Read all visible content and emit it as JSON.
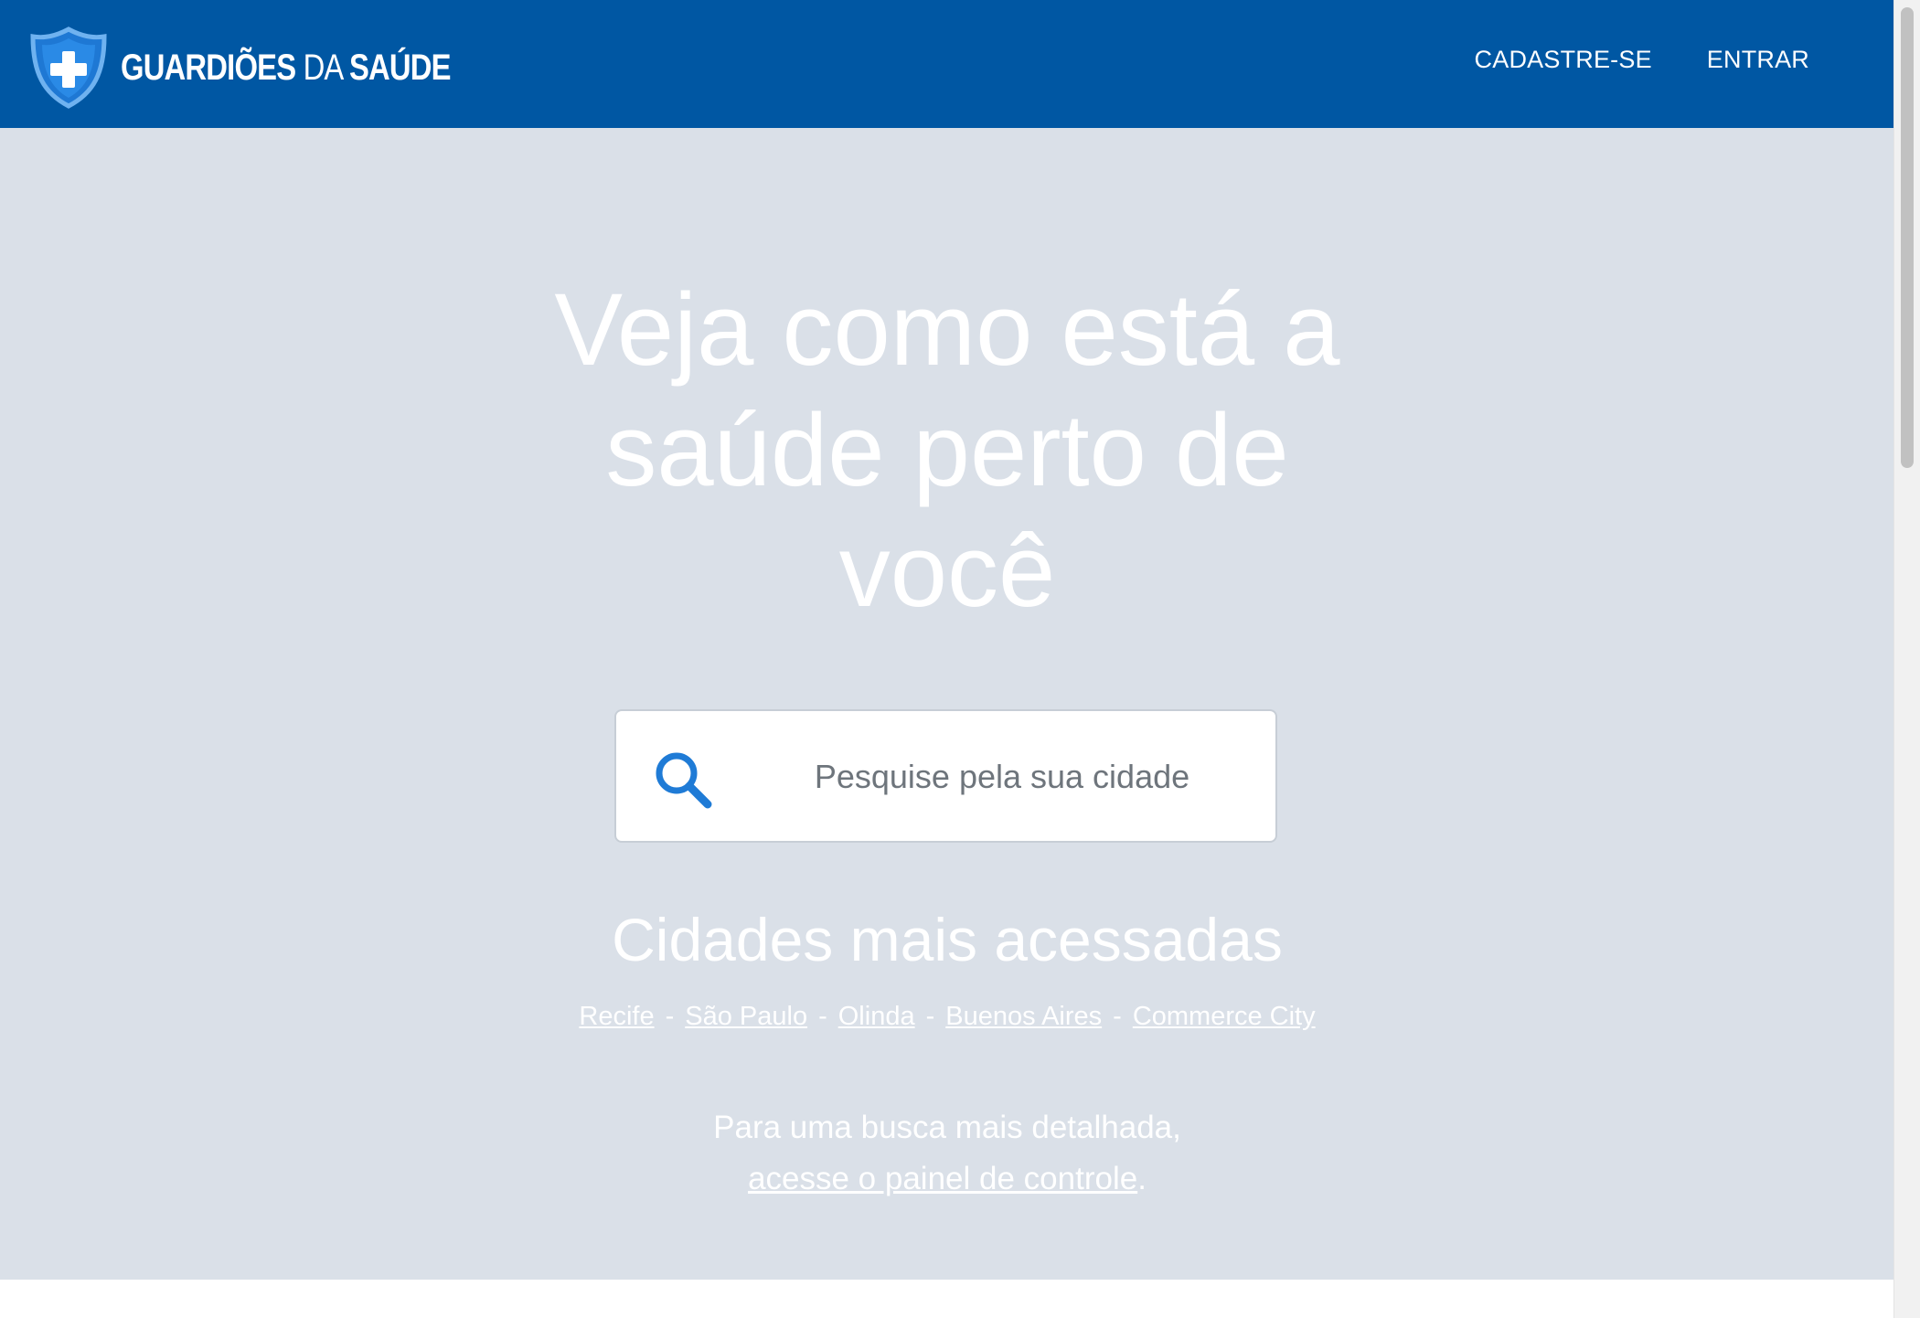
{
  "header": {
    "logo_bold_1": "GUARDIÕES",
    "logo_light": "DA",
    "logo_bold_2": "SAÚDE",
    "nav": [
      {
        "label": "CADASTRE-SE"
      },
      {
        "label": "ENTRAR"
      }
    ]
  },
  "hero": {
    "headline": "Veja como está a saúde perto de você",
    "search": {
      "placeholder": "Pesquise pela sua cidade",
      "icon": "search-icon"
    },
    "popular_title": "Cidades mais acessadas",
    "cities": [
      {
        "label": "Recife"
      },
      {
        "label": "São Paulo"
      },
      {
        "label": "Olinda"
      },
      {
        "label": "Buenos Aires"
      },
      {
        "label": "Commerce City"
      }
    ],
    "separator": "-",
    "detail_text": "Para uma busca mais detalhada,",
    "detail_link": "acesse o painel de controle",
    "detail_end": "."
  },
  "colors": {
    "header_bg": "#0057a3",
    "hero_bg": "#dae0e8",
    "accent": "#1f7bd6"
  }
}
